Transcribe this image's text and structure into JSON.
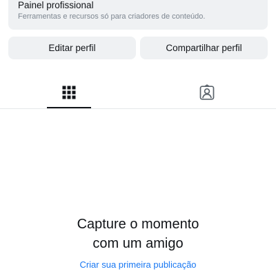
{
  "professional_dashboard": {
    "title": "Painel profissional",
    "subtitle": "Ferramentas e recursos só para criadores de conteúdo."
  },
  "actions": {
    "edit_profile_label": "Editar perfil",
    "share_profile_label": "Compartilhar perfil"
  },
  "tabs": [
    {
      "icon": "grid-icon",
      "active": true
    },
    {
      "icon": "tagged-person-icon",
      "active": false
    }
  ],
  "empty_state": {
    "title_line1": "Capture o momento",
    "title_line2": "com um amigo",
    "link_label": "Criar sua primeira publicação"
  },
  "colors": {
    "background": "#ffffff",
    "button_background": "#eff1f3",
    "text_primary": "#111418",
    "text_secondary": "#7d8690",
    "link": "#1877f2",
    "divider": "#e5e7ea"
  }
}
